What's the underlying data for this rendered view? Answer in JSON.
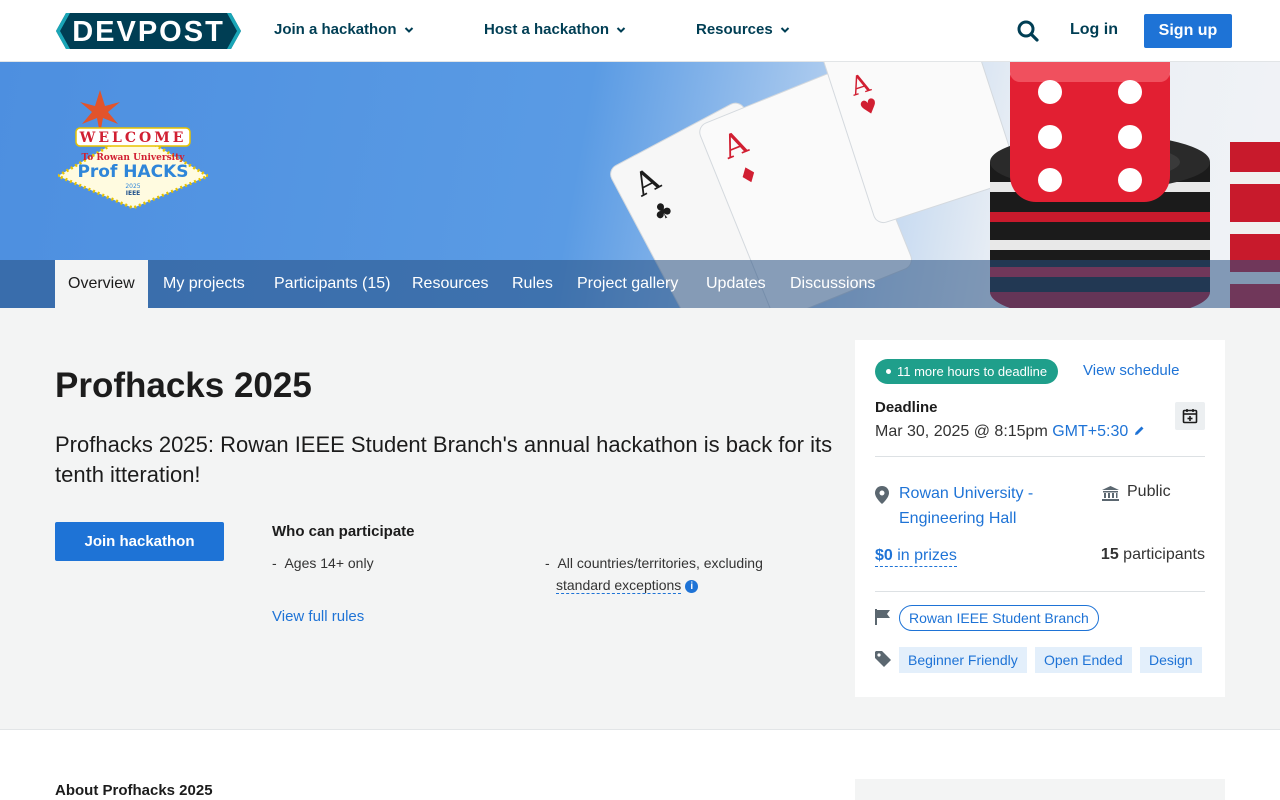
{
  "topnav": {
    "logo_text": "DEVPOST",
    "menus": [
      {
        "label": "Join a hackathon"
      },
      {
        "label": "Host a hackathon"
      },
      {
        "label": "Resources"
      }
    ],
    "login_label": "Log in",
    "signup_label": "Sign up"
  },
  "banner": {
    "logo_lines": [
      "WELCOME",
      "To Rowan University",
      "Prof HACKS",
      "2025",
      "IEEE"
    ],
    "tabs": [
      {
        "label": "Overview",
        "active": true
      },
      {
        "label": "My projects"
      },
      {
        "label": "Participants (15)"
      },
      {
        "label": "Resources"
      },
      {
        "label": "Rules"
      },
      {
        "label": "Project gallery"
      },
      {
        "label": "Updates"
      },
      {
        "label": "Discussions"
      }
    ]
  },
  "main": {
    "title": "Profhacks 2025",
    "tagline": "Profhacks 2025: Rowan IEEE Student Branch's annual hackathon is back for its tenth itteration!",
    "join_label": "Join hackathon",
    "who_title": "Who can participate",
    "eligibility": [
      {
        "text": "Ages 14+ only"
      },
      {
        "text_a": "All countries/territories, excluding",
        "text_b": "standard exceptions"
      }
    ],
    "rules_link": "View full rules"
  },
  "sidebar": {
    "deadline_pill": "11 more hours to deadline",
    "schedule_link": "View schedule",
    "deadline_label": "Deadline",
    "deadline_value": "Mar 30, 2025 @ 8:15pm",
    "timezone": "GMT+5:30",
    "location": "Rowan University - Engineering Hall",
    "visibility": "Public",
    "prizes": "$0 in prizes",
    "prize_amount": "$0",
    "prize_suffix": " in prizes",
    "participants_count": "15",
    "participants_label": "participants",
    "organizer": "Rowan IEEE Student Branch",
    "tags": [
      "Beginner Friendly",
      "Open Ended",
      "Design"
    ]
  },
  "lower": {
    "about_title": "About Profhacks 2025"
  },
  "colors": {
    "brand_dark": "#003e54",
    "accent_blue": "#1e73d6",
    "deadline_green": "#1f9f8b",
    "logo_teal": "#1aa6b7"
  }
}
